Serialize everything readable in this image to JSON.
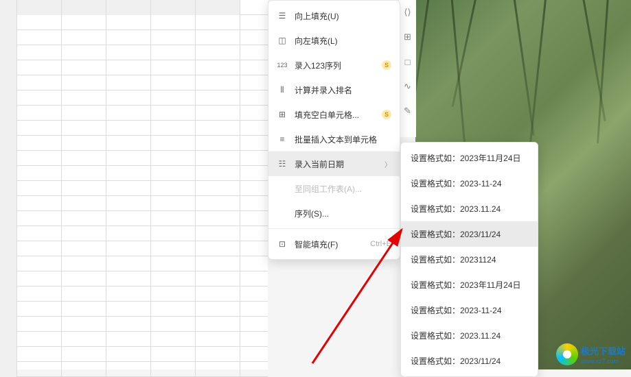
{
  "menu": {
    "items": [
      {
        "icon": "fill-up-icon",
        "label": "向上填充(U)"
      },
      {
        "icon": "fill-left-icon",
        "label": "向左填充(L)"
      },
      {
        "icon": "sequence-icon",
        "label": "录入123序列",
        "badge": "S"
      },
      {
        "icon": "rank-icon",
        "label": "计算并录入排名"
      },
      {
        "icon": "fill-blank-icon",
        "label": "填充空白单元格...",
        "badge": "S"
      },
      {
        "icon": "batch-text-icon",
        "label": "批量插入文本到单元格"
      }
    ],
    "date_item": {
      "icon": "date-icon",
      "label": "录入当前日期"
    },
    "disabled_item": {
      "label": "至同组工作表(A)..."
    },
    "series_item": {
      "label": "序列(S)..."
    },
    "smart_fill": {
      "icon": "smart-fill-icon",
      "label": "智能填充(F)",
      "shortcut": "Ctrl+E"
    }
  },
  "submenu": {
    "prefix": "设置格式如：",
    "formats": [
      "2023年11月24日",
      "2023-11-24",
      "2023.11.24",
      "2023/11/24",
      "20231124",
      "2023年11月24日",
      "2023-11-24",
      "2023.11.24",
      "2023/11/24"
    ],
    "highlighted_index": 3
  },
  "logo": {
    "name": "极光下载站",
    "url": "www.xz7.com"
  }
}
